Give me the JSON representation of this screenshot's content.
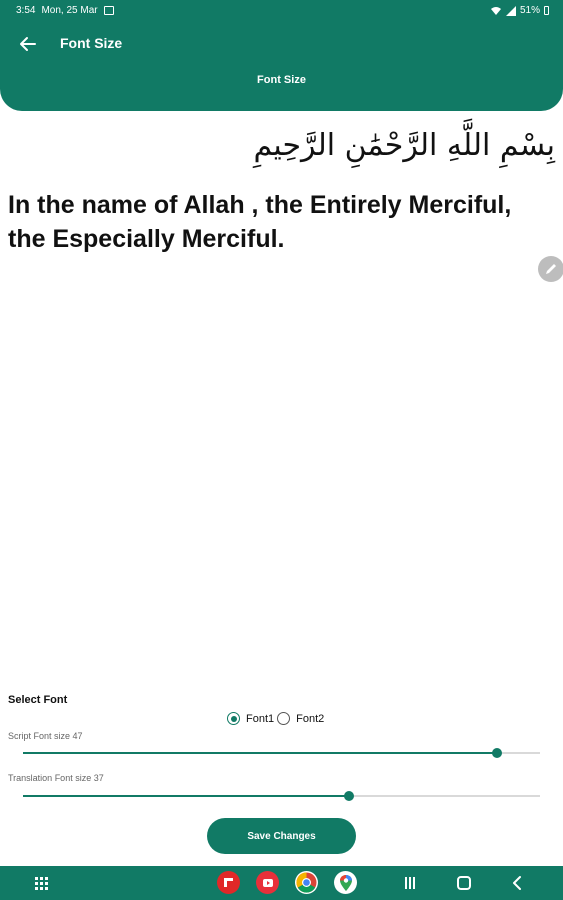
{
  "status_bar": {
    "time": "3:54",
    "date": "Mon, 25 Mar",
    "battery": "51%"
  },
  "app_bar": {
    "title": "Font Size",
    "subtitle": "Font Size",
    "color": "#117a65"
  },
  "preview": {
    "arabic": "بِسْمِ اللَّهِ الرَّحْمَٰنِ الرَّحِيمِ",
    "translation": "In the name of Allah , the Entirely Merciful, the Especially Merciful."
  },
  "settings": {
    "select_font_label": "Select Font",
    "fonts": [
      {
        "label": "Font1",
        "selected": true
      },
      {
        "label": "Font2",
        "selected": false
      }
    ],
    "script_slider": {
      "label": "Script Font size 47",
      "value_fraction": 0.917
    },
    "translation_slider": {
      "label": "Translation Font size 37",
      "value_fraction": 0.63
    },
    "save_label": "Save Changes"
  },
  "nav_bar": {
    "dock_apps": [
      "flipboard-icon",
      "youtube-music-icon",
      "chrome-icon",
      "maps-icon"
    ]
  }
}
